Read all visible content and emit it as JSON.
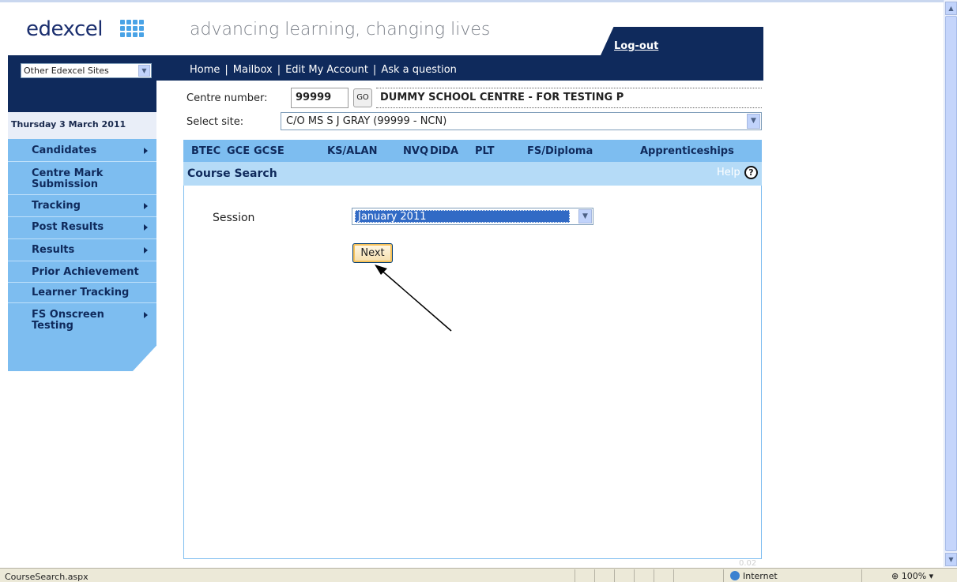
{
  "logo": {
    "text": "edexcel"
  },
  "tagline": "advancing learning, changing lives",
  "logout": "Log-out",
  "other_sites": "Other Edexcel Sites",
  "topnav": [
    "Home",
    "Mailbox",
    "Edit My Account",
    "Ask a question"
  ],
  "date": "Thursday 3 March 2011",
  "centre": {
    "label": "Centre number:",
    "number": "99999",
    "go": "GO",
    "name": "DUMMY SCHOOL CENTRE - FOR TESTING P"
  },
  "site": {
    "label": "Select site:",
    "value": "C/O MS S J GRAY (99999 - NCN)"
  },
  "sidebar": [
    {
      "label": "Candidates",
      "arrow": true
    },
    {
      "label": "Centre Mark Submission",
      "arrow": false
    },
    {
      "label": "Tracking",
      "arrow": true
    },
    {
      "label": "Post Results",
      "arrow": true
    },
    {
      "label": "Results",
      "arrow": true
    },
    {
      "label": "Prior Achievement",
      "arrow": false
    },
    {
      "label": "Learner Tracking",
      "arrow": false
    },
    {
      "label": "FS Onscreen Testing",
      "arrow": true
    }
  ],
  "tabs": [
    "BTEC",
    "GCE",
    "GCSE",
    "KS/ALAN",
    "NVQ",
    "DiDA",
    "PLT",
    "FS/Diploma",
    "Apprenticeships"
  ],
  "content": {
    "title": "Course Search",
    "help": "Help",
    "help_icon": "?",
    "session_label": "Session",
    "session_value": "January 2011",
    "next": "Next",
    "version": "0.02"
  },
  "status": {
    "url": "CourseSearch.aspx",
    "zone": "Internet",
    "zoom": "100%"
  },
  "colors": {
    "navy": "#0f2a5c",
    "light_blue": "#7dbdf0",
    "header_blue": "#b5dbf7"
  }
}
